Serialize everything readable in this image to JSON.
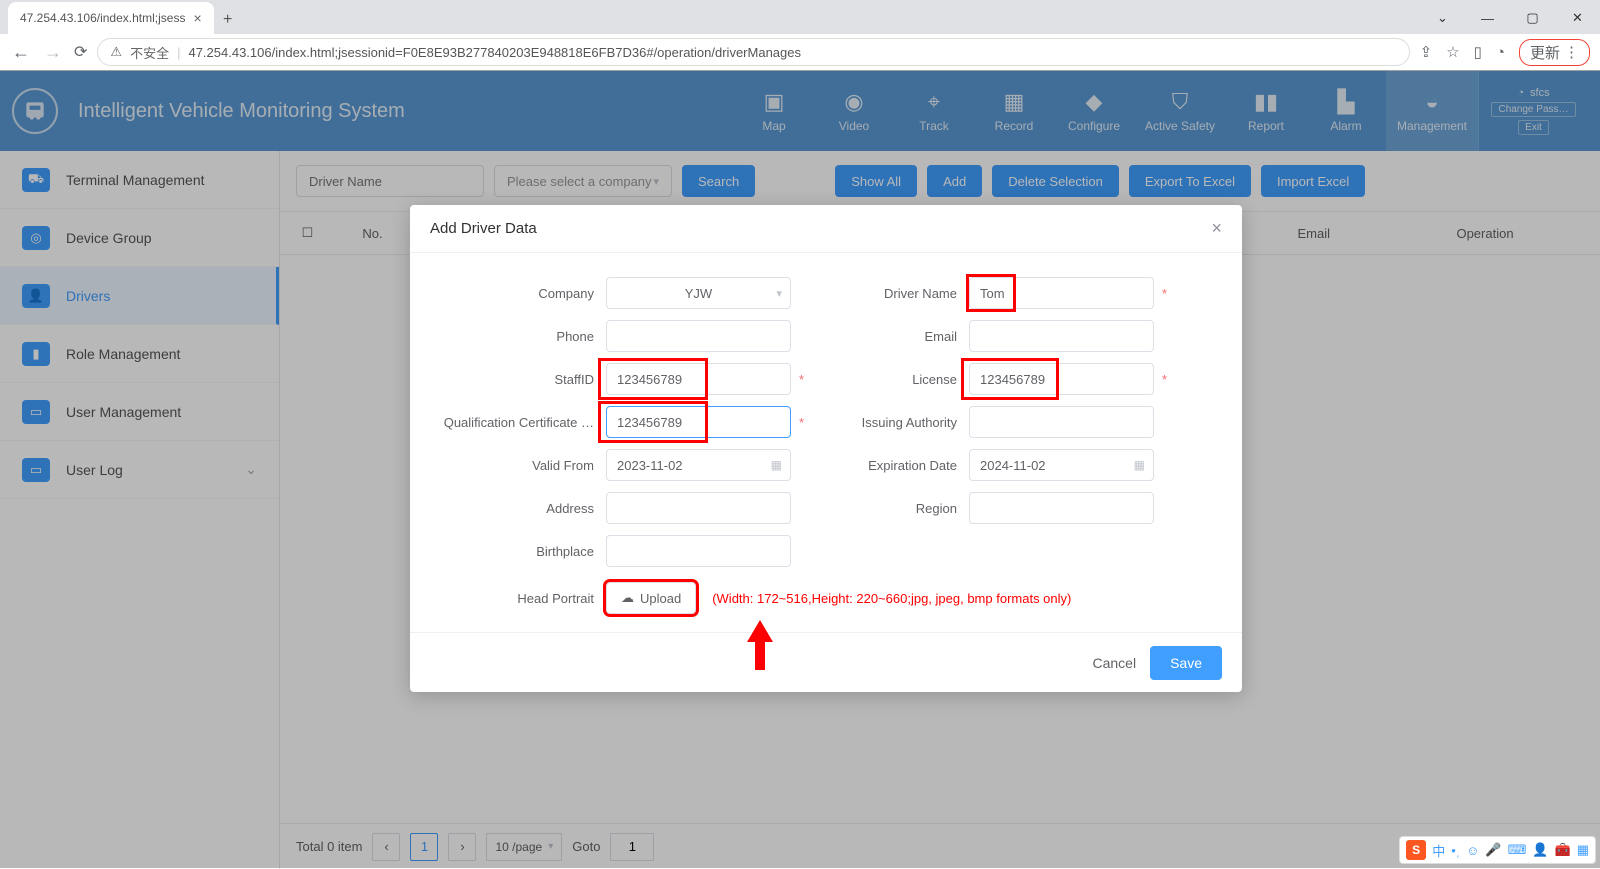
{
  "browser": {
    "tab_title": "47.254.43.106/index.html;jsess",
    "insecure_label": "不安全",
    "url": "47.254.43.106/index.html;jsessionid=F0E8E93B277840203E948818E6FB7D36#/operation/driverManages",
    "update_label": "更新"
  },
  "header": {
    "app_title": "Intelligent Vehicle Monitoring System",
    "nav": [
      {
        "label": "Map",
        "icon": "▣"
      },
      {
        "label": "Video",
        "icon": "◉"
      },
      {
        "label": "Track",
        "icon": "⌖"
      },
      {
        "label": "Record",
        "icon": "▦"
      },
      {
        "label": "Configure",
        "icon": "◆"
      },
      {
        "label": "Active Safety",
        "icon": "⛉"
      },
      {
        "label": "Report",
        "icon": "▮"
      },
      {
        "label": "Alarm",
        "icon": "▙"
      },
      {
        "label": "Management",
        "icon": "◒"
      }
    ],
    "user": {
      "name": "sfcs",
      "change_pass": "Change Pass…",
      "exit": "Exit"
    }
  },
  "sidebar": [
    {
      "label": "Terminal Management"
    },
    {
      "label": "Device Group"
    },
    {
      "label": "Drivers",
      "active": true
    },
    {
      "label": "Role Management"
    },
    {
      "label": "User Management"
    },
    {
      "label": "User Log",
      "expandable": true
    }
  ],
  "toolbar": {
    "driver_name_placeholder": "Driver Name",
    "company_placeholder": "Please select a company",
    "search": "Search",
    "show_all": "Show All",
    "add": "Add",
    "delete_selection": "Delete Selection",
    "export_excel": "Export To Excel",
    "import_excel": "Import Excel"
  },
  "table": {
    "columns": {
      "no": "No.",
      "email": "Email",
      "operation": "Operation"
    }
  },
  "pager": {
    "total_label": "Total 0 item",
    "page": "1",
    "per_page": "10 /page",
    "goto_label": "Goto",
    "goto_value": "1"
  },
  "modal": {
    "title": "Add Driver Data",
    "labels": {
      "company": "Company",
      "driver_name": "Driver Name",
      "phone": "Phone",
      "email": "Email",
      "staff_id": "StaffID",
      "license": "License",
      "qualification": "Qualification Certificate …",
      "issuing_authority": "Issuing Authority",
      "valid_from": "Valid From",
      "expiration_date": "Expiration Date",
      "address": "Address",
      "region": "Region",
      "birthplace": "Birthplace",
      "head_portrait": "Head Portrait"
    },
    "values": {
      "company": "YJW",
      "driver_name": "Tom",
      "phone": "",
      "email": "",
      "staff_id": "123456789",
      "license": "123456789",
      "qualification": "123456789",
      "issuing_authority": "",
      "valid_from": "2023-11-02",
      "expiration_date": "2024-11-02",
      "address": "",
      "region": "",
      "birthplace": ""
    },
    "required_marker": "*",
    "upload_label": "Upload",
    "upload_note": "(Width: 172~516,Height: 220~660;jpg, jpeg, bmp formats only)",
    "cancel": "Cancel",
    "save": "Save"
  },
  "ime": {
    "zh": "中"
  }
}
